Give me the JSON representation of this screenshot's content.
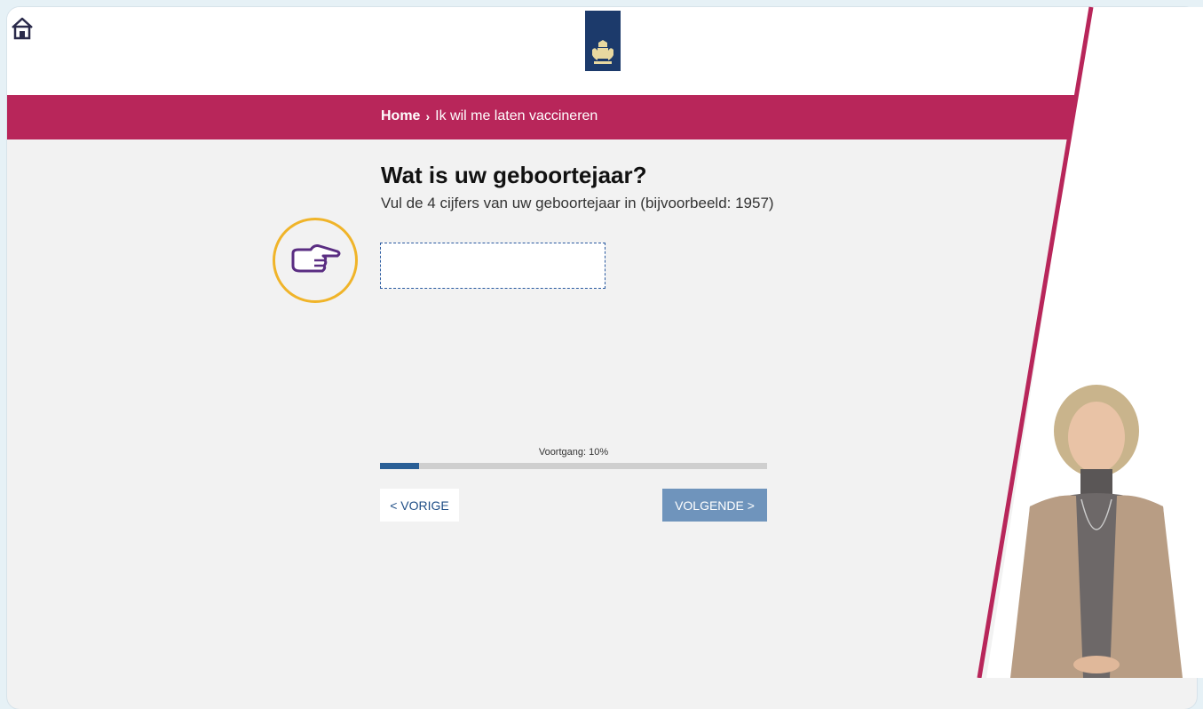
{
  "header": {
    "home_icon": "house-icon",
    "logo": "coat-of-arms-logo"
  },
  "breadcrumb": {
    "home": "Home",
    "separator": "›",
    "current": "Ik wil me laten vaccineren"
  },
  "question": {
    "title": "Wat is uw geboortejaar?",
    "instruction": "Vul de 4 cijfers van uw geboortejaar in (bijvoorbeeld: 1957)",
    "input_value": "",
    "pointer_icon": "pointing-hand-icon"
  },
  "progress": {
    "label": "Voortgang: 10%",
    "value": 0.1
  },
  "buttons": {
    "prev": "< VORIGE",
    "next": "VOLGENDE >"
  },
  "colors": {
    "accent": "#b8265a",
    "primary_blue": "#1c3a6b",
    "button_next": "#6f94bc",
    "highlight": "#f0b429"
  }
}
